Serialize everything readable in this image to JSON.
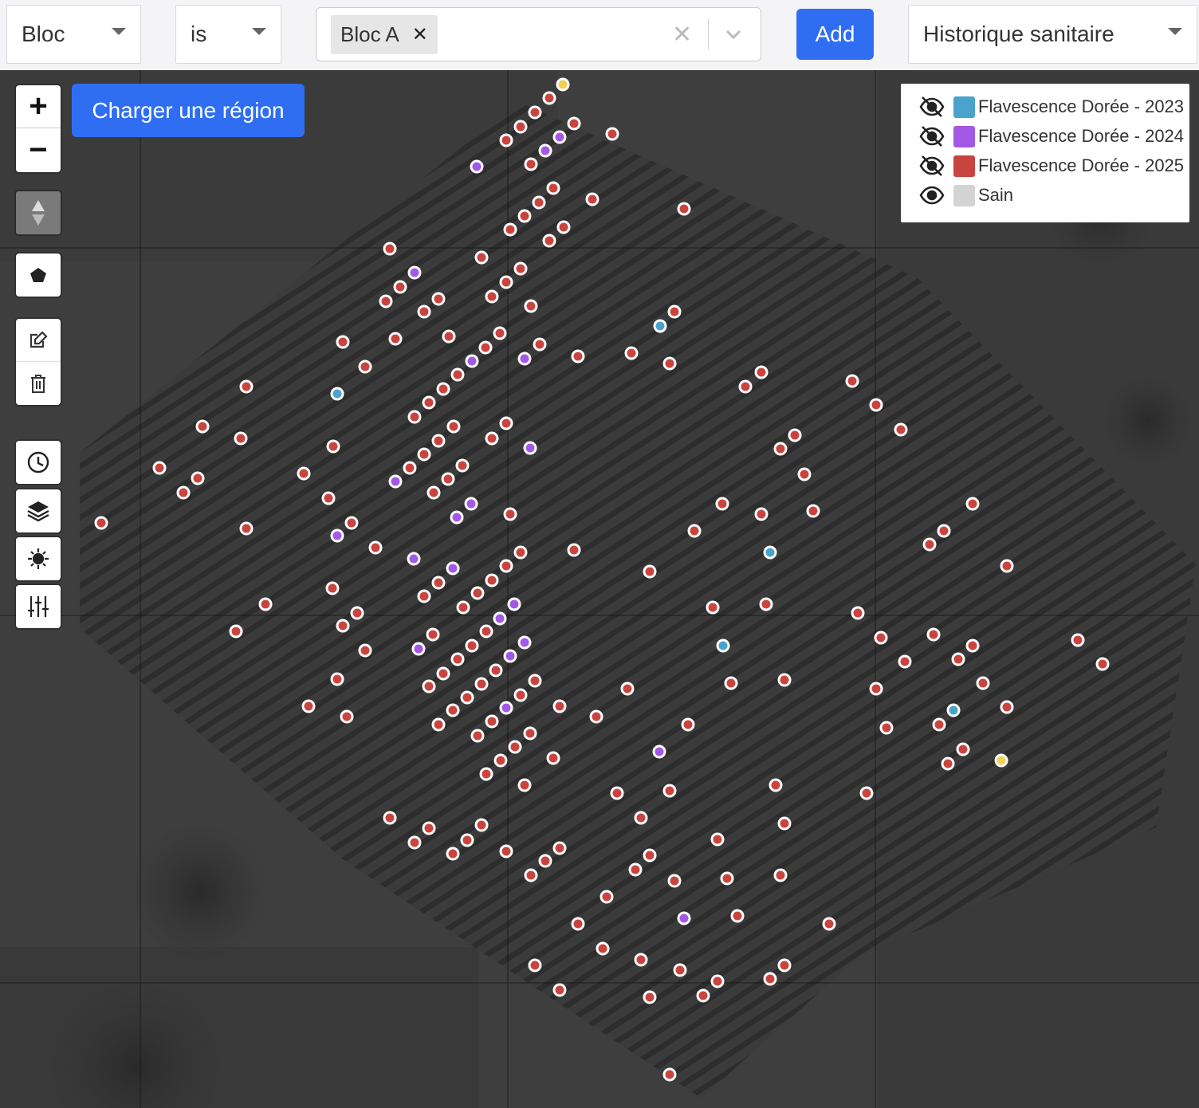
{
  "filter_bar": {
    "field_select": {
      "value": "Bloc"
    },
    "operator_select": {
      "value": "is"
    },
    "value_multiselect": {
      "chips": [
        "Bloc A"
      ]
    },
    "add_button": "Add",
    "history_select": {
      "value": "Historique sanitaire"
    }
  },
  "map": {
    "zoom_in": "+",
    "zoom_out": "−",
    "load_region_button": "Charger une région",
    "tools": [
      "compass-icon",
      "polygon-icon",
      "edit-icon",
      "trash-icon",
      "history-icon",
      "layers-icon",
      "brightness-icon",
      "sliders-icon"
    ]
  },
  "legend": {
    "items": [
      {
        "label": "Flavescence Dorée - 2023",
        "color": "#4aa3cc",
        "visible": false
      },
      {
        "label": "Flavescence Dorée - 2024",
        "color": "#a259e6",
        "visible": false
      },
      {
        "label": "Flavescence Dorée - 2025",
        "color": "#c9443f",
        "visible": false
      },
      {
        "label": "Sain",
        "color": "#d3d3d3",
        "visible": true
      }
    ]
  },
  "colors": {
    "fd_2023": "#4aa3cc",
    "fd_2024": "#a259e6",
    "fd_2025": "#c9443f",
    "highlight": "#f2cf56",
    "accent": "#2f6ef2"
  }
}
